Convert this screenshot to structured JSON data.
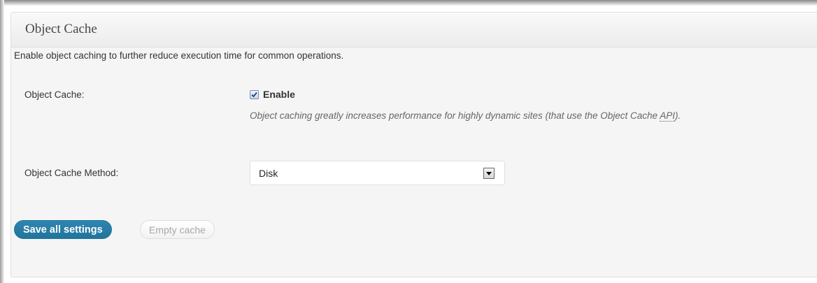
{
  "panel": {
    "title": "Object Cache",
    "description": "Enable object caching to further reduce execution time for common operations."
  },
  "object_cache": {
    "label": "Object Cache:",
    "checkbox_checked": true,
    "checkbox_label": "Enable",
    "help_before": "Object caching greatly increases performance for highly dynamic sites (that use the Object Cache ",
    "help_abbr": "API",
    "help_after": ")."
  },
  "method": {
    "label": "Object Cache Method:",
    "selected": "Disk",
    "icon": "dropdown-arrow-icon"
  },
  "buttons": {
    "save_label": "Save all settings",
    "empty_label": "Empty cache"
  },
  "colors": {
    "primary_button": "#21759b",
    "panel_background": "#f5f5f5"
  }
}
